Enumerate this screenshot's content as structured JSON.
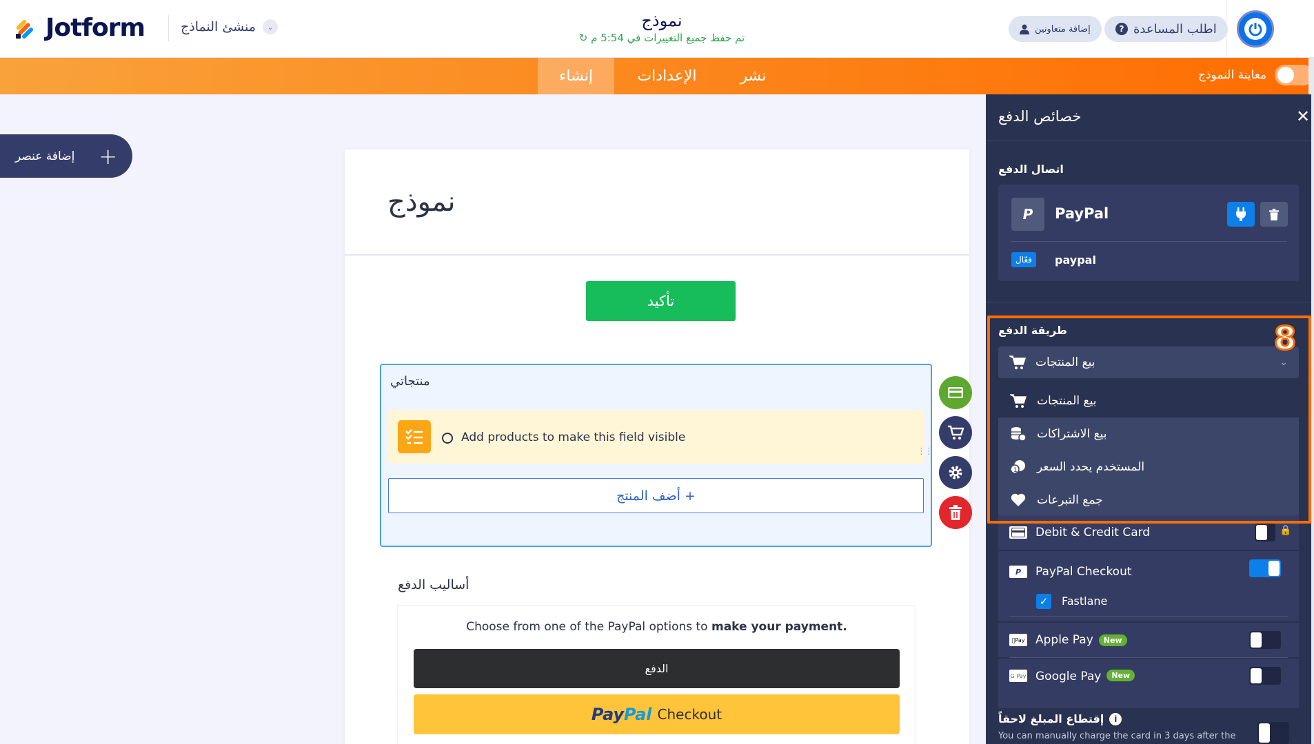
{
  "app": {
    "brand": "Jotform",
    "builder_label": "منشئ النماذج",
    "form_title": "نموذج",
    "saved_status": "تم حفظ جميع التغييرات في 5:54 م",
    "collab_button": "إضافة متعاونين",
    "help_button": "اطلب المساعدة"
  },
  "nav": {
    "build": "إنشاء",
    "settings": "الإعدادات",
    "publish": "نشر",
    "preview_label": "معاينة النموذج"
  },
  "left": {
    "add_element": "إضافة عنصر"
  },
  "form": {
    "heading": "نموذج",
    "confirm_button": "تأكيد",
    "product_field_label": "منتجاتي",
    "notice_text": "Add products to make this field visible",
    "add_product_button": "أضف المنتج +",
    "payment_methods_label": "أساليب الدفع",
    "paypal_choose_prefix": "Choose from one of the PayPal options to ",
    "paypal_choose_bold": "make your payment.",
    "pay_button": "الدفع",
    "paypal_logo_a": "Pay",
    "paypal_logo_b": "Pal",
    "paypal_checkout_word": "Checkout"
  },
  "panel": {
    "title": "خصائص الدفع",
    "connection_label": "اتصال الدفع",
    "gateway_name": "PayPal",
    "account_name": "paypal",
    "active_badge": "فعّال",
    "step_number": "8",
    "method_label": "طريقة الدفع",
    "method_selected": "بيع المنتجات",
    "method_options": [
      {
        "label": "بيع المنتجات",
        "icon": "cart-icon"
      },
      {
        "label": "بيع الاشتراكات",
        "icon": "coins-icon"
      },
      {
        "label": "المستخدم يحدد السعر",
        "icon": "user-price-icon"
      },
      {
        "label": "جمع التبرعات",
        "icon": "heart-icon"
      }
    ],
    "payment_options": {
      "card": "Debit & Credit Card",
      "paypal_checkout": "PayPal Checkout",
      "fastlane": "Fastlane",
      "apple_pay": "Apple Pay",
      "google_pay": "Google Pay",
      "new_badge": "New"
    },
    "capture_label": "إقتطاع المبلغ لاحقاً",
    "capture_desc": "You can manually charge the card in 3 days after the"
  },
  "colors": {
    "orange": "#ff6d00",
    "panel_bg": "#293250",
    "green": "#18bd5b",
    "blue": "#0d7fe8"
  }
}
